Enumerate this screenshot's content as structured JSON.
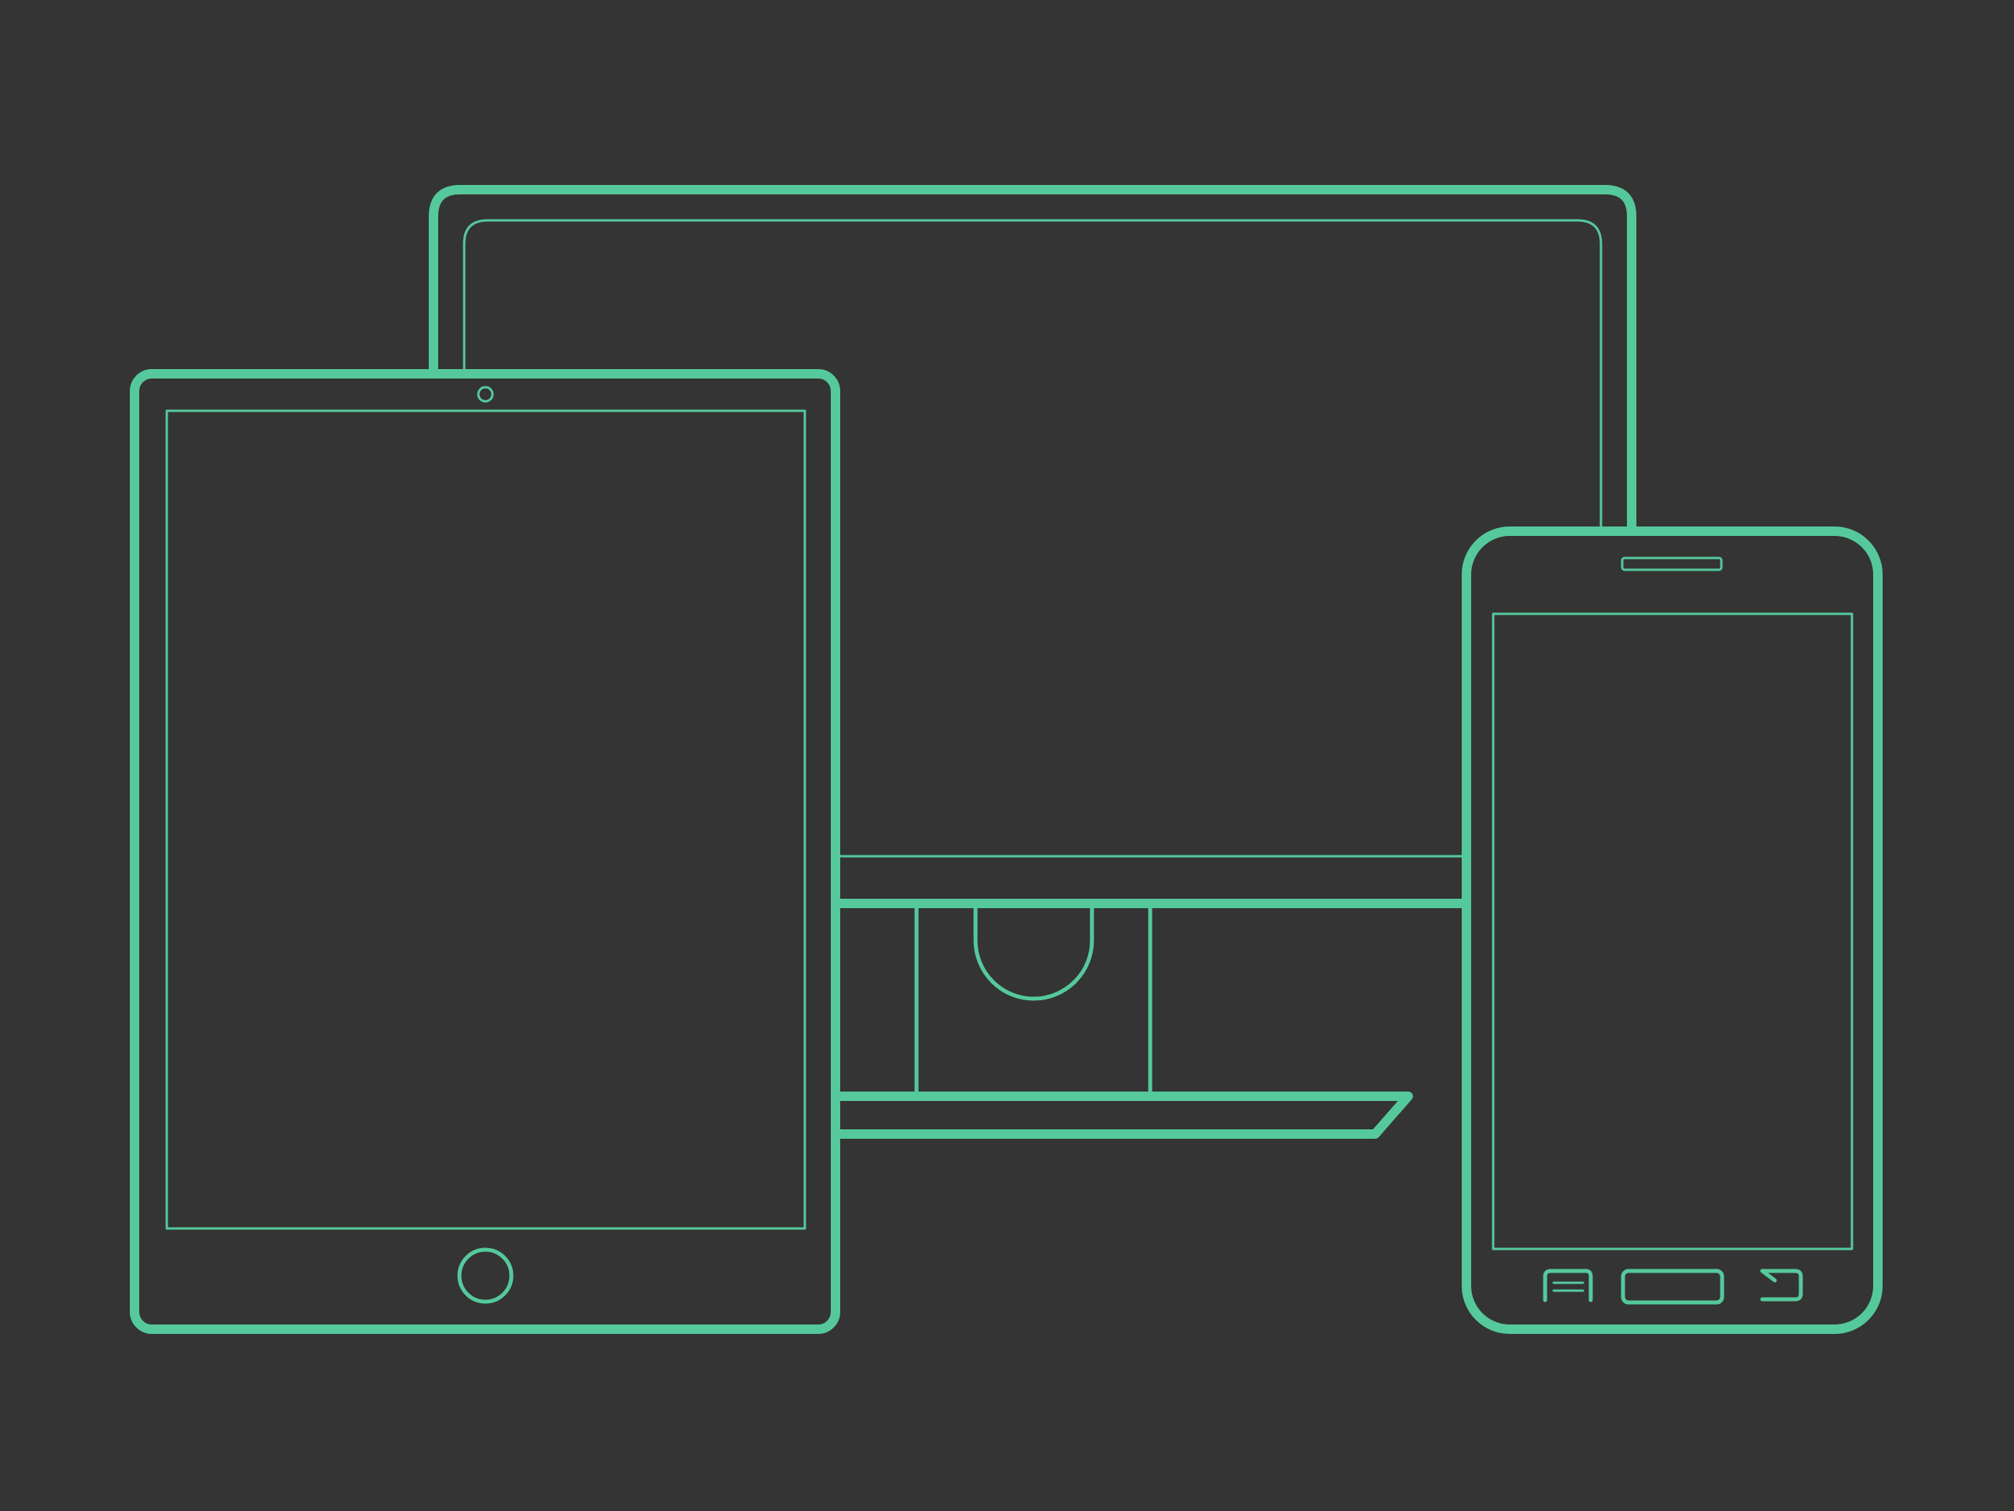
{
  "colors": {
    "background": "#343434",
    "outline": "#55C99C"
  },
  "devices": [
    {
      "name": "desktop-monitor",
      "icon": "monitor-icon"
    },
    {
      "name": "tablet",
      "icon": "tablet-icon"
    },
    {
      "name": "smartphone",
      "icon": "smartphone-icon"
    }
  ]
}
